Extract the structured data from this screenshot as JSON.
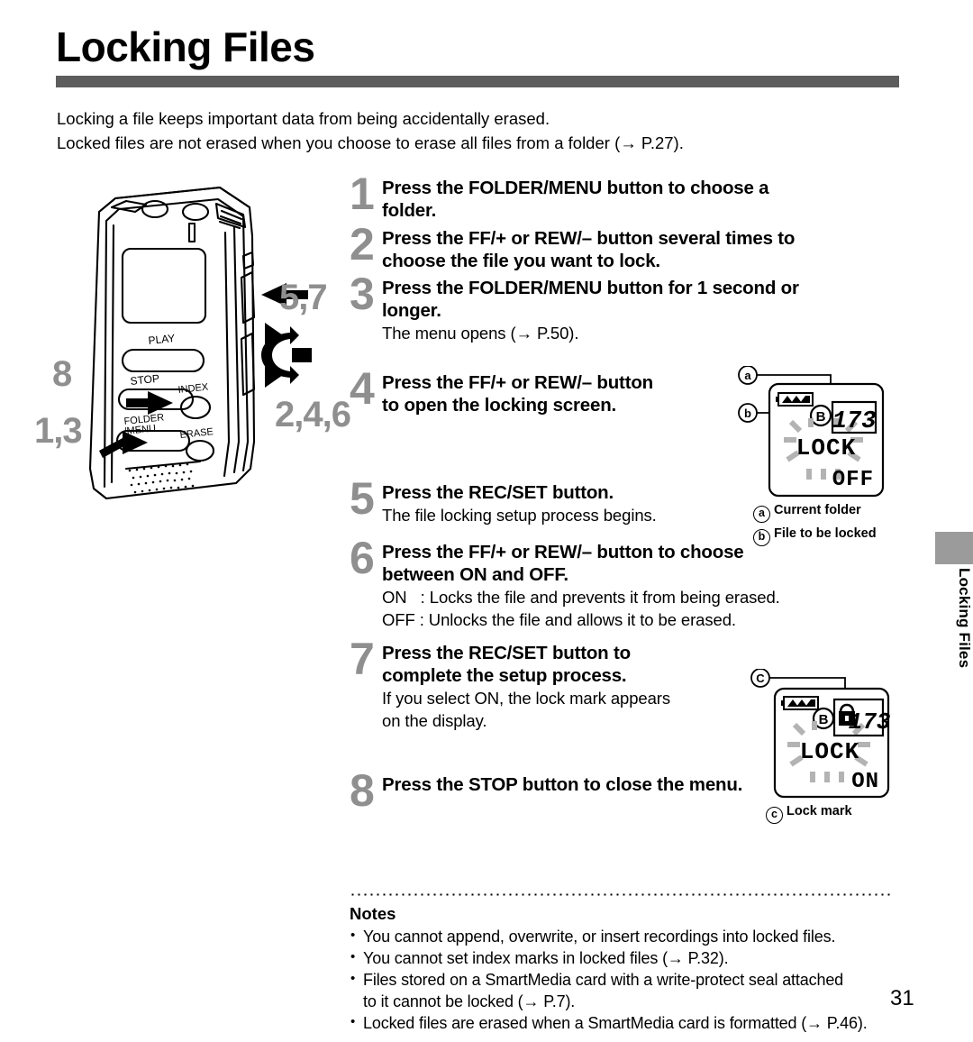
{
  "page": {
    "title": "Locking Files",
    "number": "31",
    "side_tab_label": "Locking Files",
    "accent_rule_color": "#5d5d5d",
    "step_number_color": "#8f8f8f",
    "side_tab_color": "#9b9b9b"
  },
  "intro": {
    "line1": "Locking a file keeps important data from being accidentally erased.",
    "line2": "Locked files are not erased when you choose to erase all files from a folder (→ P.27)."
  },
  "device": {
    "caption_buttons": [
      "PLAY",
      "STOP",
      "INDEX",
      "FOLDER",
      "/MENU",
      "ERASE"
    ],
    "callouts": [
      {
        "label": "5,7",
        "name": "callout-rec-set"
      },
      {
        "label": "2,4,6",
        "name": "callout-ff-rew"
      },
      {
        "label": "8",
        "name": "callout-stop"
      },
      {
        "label": "1,3",
        "name": "callout-folder-menu"
      }
    ]
  },
  "steps": [
    {
      "num": "1",
      "head_line1": "Press the FOLDER/MENU button to choose a",
      "head_line2": "folder.",
      "body": []
    },
    {
      "num": "2",
      "head_line1": "Press the FF/+ or REW/– button several times to",
      "head_line2": "choose the file you want to lock.",
      "body": []
    },
    {
      "num": "3",
      "head_line1": "Press the FOLDER/MENU button for 1 second or",
      "head_line2": "longer.",
      "body": [
        "The menu opens (→ P.50)."
      ]
    },
    {
      "num": "4",
      "head_line1": "Press the FF/+ or REW/– button",
      "head_line2": "to open the locking screen.",
      "body": []
    },
    {
      "num": "5",
      "head_line1": "Press the REC/SET button.",
      "head_line2": "",
      "body": [
        "The file locking setup process begins."
      ]
    },
    {
      "num": "6",
      "head_line1": "Press the FF/+ or REW/– button to choose",
      "head_line2": "between ON and OFF.",
      "body": [
        "ON   : Locks the file and prevents it from being erased.",
        "OFF : Unlocks the file and allows it to be erased."
      ]
    },
    {
      "num": "7",
      "head_line1": "Press the REC/SET button to",
      "head_line2": "complete the setup process.",
      "body": [
        "If you select ON, the lock mark appears",
        "on the display."
      ]
    },
    {
      "num": "8",
      "head_line1": "Press the STOP button to close the menu.",
      "head_line2": "",
      "body": []
    }
  ],
  "lcd_top": {
    "folder": "B",
    "file_number": "173",
    "mode_label": "LOCK",
    "value": "OFF",
    "legend": [
      {
        "mark": "a",
        "text": "Current folder"
      },
      {
        "mark": "b",
        "text": "File to be locked"
      }
    ]
  },
  "lcd_bottom": {
    "folder": "B",
    "file_number": "173",
    "mode_label": "LOCK",
    "value": "ON",
    "lock_icon": "padlock-icon",
    "legend": [
      {
        "mark": "c",
        "text": "Lock mark"
      }
    ]
  },
  "notes": {
    "title": "Notes",
    "items": [
      "You cannot append, overwrite, or insert recordings into locked files.",
      "You cannot set index marks in locked files (→ P.32).",
      "Files stored on a SmartMedia card with a write-protect seal attached",
      "to it cannot be locked (→ P.7).",
      "Locked files are erased when a SmartMedia card is formatted (→ P.46)."
    ],
    "bullet": "•"
  }
}
